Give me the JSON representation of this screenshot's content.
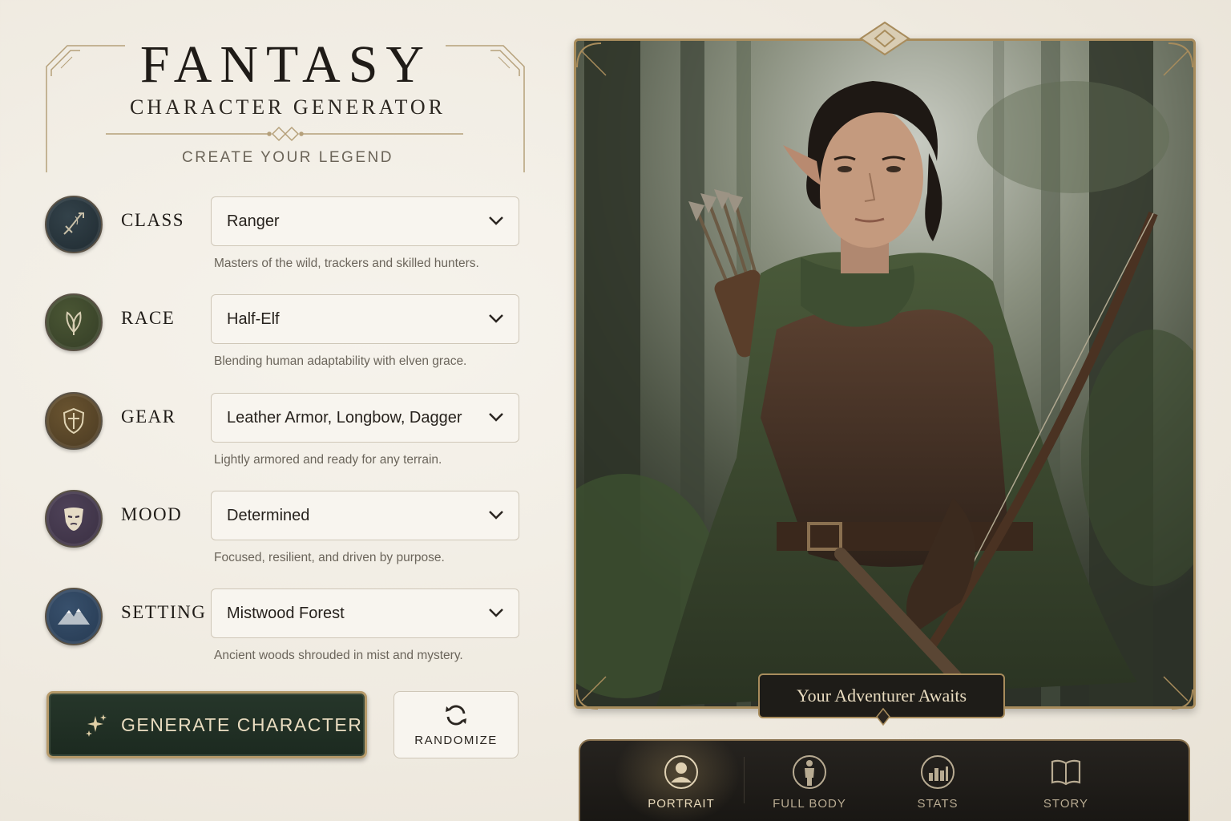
{
  "header": {
    "title": "FANTASY",
    "subtitle": "CHARACTER GENERATOR",
    "tagline": "CREATE YOUR LEGEND"
  },
  "fields": [
    {
      "label": "CLASS",
      "value": "Ranger",
      "description": "Masters of the wild, trackers and skilled hunters.",
      "icon": "sword-icon",
      "color": "#1f2a30"
    },
    {
      "label": "RACE",
      "value": "Half-Elf",
      "description": "Blending human adaptability with elven grace.",
      "icon": "leaf-icon",
      "color": "#343d26"
    },
    {
      "label": "GEAR",
      "value": "Leather Armor, Longbow, Dagger",
      "description": "Lightly armored and ready for any terrain.",
      "icon": "shield-icon",
      "color": "#4a3a22"
    },
    {
      "label": "MOOD",
      "value": "Determined",
      "description": "Focused, resilient, and driven by purpose.",
      "icon": "mask-icon",
      "color": "#3a2f42"
    },
    {
      "label": "SETTING",
      "value": "Mistwood Forest",
      "description": "Ancient woods shrouded in mist and mystery.",
      "icon": "mountain-icon",
      "color": "#263a52"
    }
  ],
  "actions": {
    "generate_label": "GENERATE CHARACTER",
    "randomize_label": "RANDOMIZE"
  },
  "portrait": {
    "caption": "Your Adventurer Awaits"
  },
  "tabs": [
    {
      "label": "PORTRAIT",
      "icon": "portrait-icon",
      "active": true
    },
    {
      "label": "FULL BODY",
      "icon": "full-body-icon",
      "active": false
    },
    {
      "label": "STATS",
      "icon": "stats-icon",
      "active": false
    },
    {
      "label": "STORY",
      "icon": "book-icon",
      "active": false
    }
  ],
  "colors": {
    "accent_gold": "#a88c5c",
    "primary_green": "#1f2e23",
    "background": "#efeae0"
  }
}
